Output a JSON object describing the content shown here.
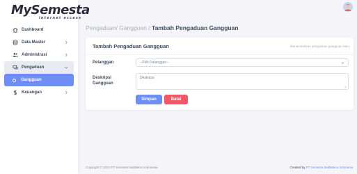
{
  "brand": {
    "name": "MySemesta",
    "tagline": "internet access"
  },
  "sidebar": {
    "items": [
      {
        "label": "Dashboard",
        "icon": "home-icon"
      },
      {
        "label": "Data Master",
        "icon": "database-icon"
      },
      {
        "label": "Administrasi",
        "icon": "users-icon"
      },
      {
        "label": "Pengaduan",
        "icon": "chat-icon"
      },
      {
        "label": "Gangguan",
        "icon": "circle-icon"
      },
      {
        "label": "Keuangan",
        "icon": "dollar-icon"
      }
    ]
  },
  "breadcrumb": {
    "parent": "Pengaduan/ Gangguan /",
    "current": "Tambah Pengaduan Gangguan"
  },
  "form": {
    "title": "Tambah Pengaduan Gangguan",
    "hint": "Menambahkan pengaduan gangguan baru",
    "pelanggan_label": "Pelanggan",
    "pelanggan_placeholder": "--Pilih Pelanggan--",
    "deskripsi_label_1": "Deskripsi",
    "deskripsi_label_2": "Gangguan",
    "deskripsi_placeholder": "Deskripsi",
    "save_label": "Simpan",
    "cancel_label": "Batal"
  },
  "footer": {
    "copyright": "Copyright © 2024 PT Semesta Multitekno Indonesia",
    "created_prefix": "Created by",
    "created_link": "PT Semesta Multitekno Indonesia"
  },
  "colors": {
    "accent": "#6e8ef5",
    "danger": "#f2576a",
    "background": "#f5f5f9"
  }
}
